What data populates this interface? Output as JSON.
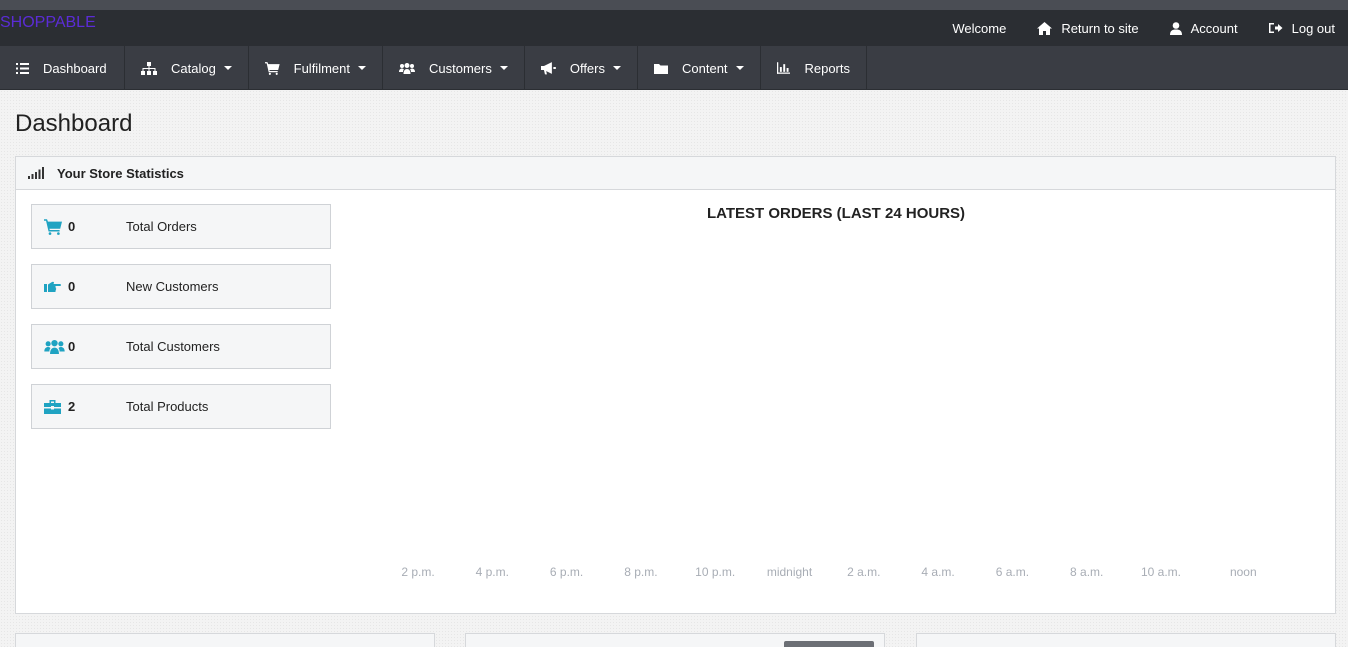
{
  "header": {
    "brand": "SHOPPABLE",
    "welcome": "Welcome",
    "return_to_site": "Return to site",
    "account": "Account",
    "logout": "Log out"
  },
  "nav": {
    "items": [
      {
        "label": "Dashboard",
        "icon": "list-icon",
        "dropdown": false
      },
      {
        "label": "Catalog",
        "icon": "sitemap-icon",
        "dropdown": true
      },
      {
        "label": "Fulfilment",
        "icon": "cart-icon",
        "dropdown": true
      },
      {
        "label": "Customers",
        "icon": "users-icon",
        "dropdown": true
      },
      {
        "label": "Offers",
        "icon": "megaphone-icon",
        "dropdown": true
      },
      {
        "label": "Content",
        "icon": "folder-icon",
        "dropdown": true
      },
      {
        "label": "Reports",
        "icon": "bar-chart-icon",
        "dropdown": false
      }
    ]
  },
  "page": {
    "title": "Dashboard"
  },
  "stats_panel": {
    "title": "Your Store Statistics",
    "stats": [
      {
        "value": "0",
        "label": "Total Orders",
        "icon": "cart-icon"
      },
      {
        "value": "0",
        "label": "New Customers",
        "icon": "hand-point-icon"
      },
      {
        "value": "0",
        "label": "Total Customers",
        "icon": "users-icon"
      },
      {
        "value": "2",
        "label": "Total Products",
        "icon": "briefcase-icon"
      }
    ]
  },
  "colors": {
    "header_bg": "#2b2e33",
    "nav_bg": "#3a3d44",
    "brand": "#5b2cd6",
    "stat_icon": "#1fa3c2",
    "tick_text": "#a8adb5"
  },
  "chart_data": {
    "type": "line",
    "title": "LATEST ORDERS (LAST 24 HOURS)",
    "x": [
      "2 p.m.",
      "4 p.m.",
      "6 p.m.",
      "8 p.m.",
      "10 p.m.",
      "midnight",
      "2 a.m.",
      "4 a.m.",
      "6 a.m.",
      "8 a.m.",
      "10 a.m.",
      "noon"
    ],
    "series": [],
    "xlabel": "",
    "ylabel": "",
    "grid": false
  }
}
